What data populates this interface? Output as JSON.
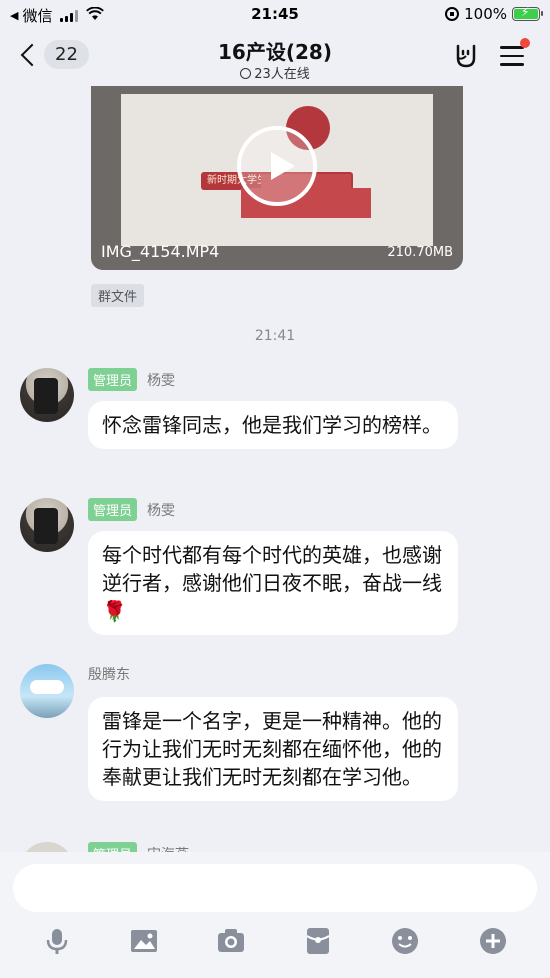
{
  "status_bar": {
    "back_app": "微信",
    "time": "21:45",
    "battery": "100%"
  },
  "nav": {
    "back_count": "22",
    "title": "16产设(28)",
    "subtitle": "23人在线"
  },
  "video": {
    "banner_text": "新时期大学生如何传承雷锋精神",
    "filename": "IMG_4154.MP4",
    "size": "210.70MB",
    "tag": "群文件"
  },
  "timestamp": "21:41",
  "messages": [
    {
      "role": "管理员",
      "sender": "杨雯",
      "text": "怀念雷锋同志，他是我们学习的榜样。"
    },
    {
      "role": "管理员",
      "sender": "杨雯",
      "text": "每个时代都有每个时代的英雄，也感谢逆行者，感谢他们日夜不眠，奋战一线🌹"
    },
    {
      "role": "",
      "sender": "殷腾东",
      "text": "雷锋是一个名字，更是一种精神。他的行为让我们无时无刻都在缅怀他，他的奉献更让我们无时无刻都在学习他。"
    },
    {
      "role": "管理员",
      "sender": "宋海燕",
      "text": ""
    }
  ],
  "input": {
    "placeholder": ""
  },
  "toolbar_icons": [
    "mic-icon",
    "image-icon",
    "camera-icon",
    "red-packet-icon",
    "emoji-icon",
    "plus-icon"
  ],
  "colors": {
    "admin_badge": "#7fd093",
    "notify_dot": "#f0483e",
    "bg": "#eef0f5"
  }
}
